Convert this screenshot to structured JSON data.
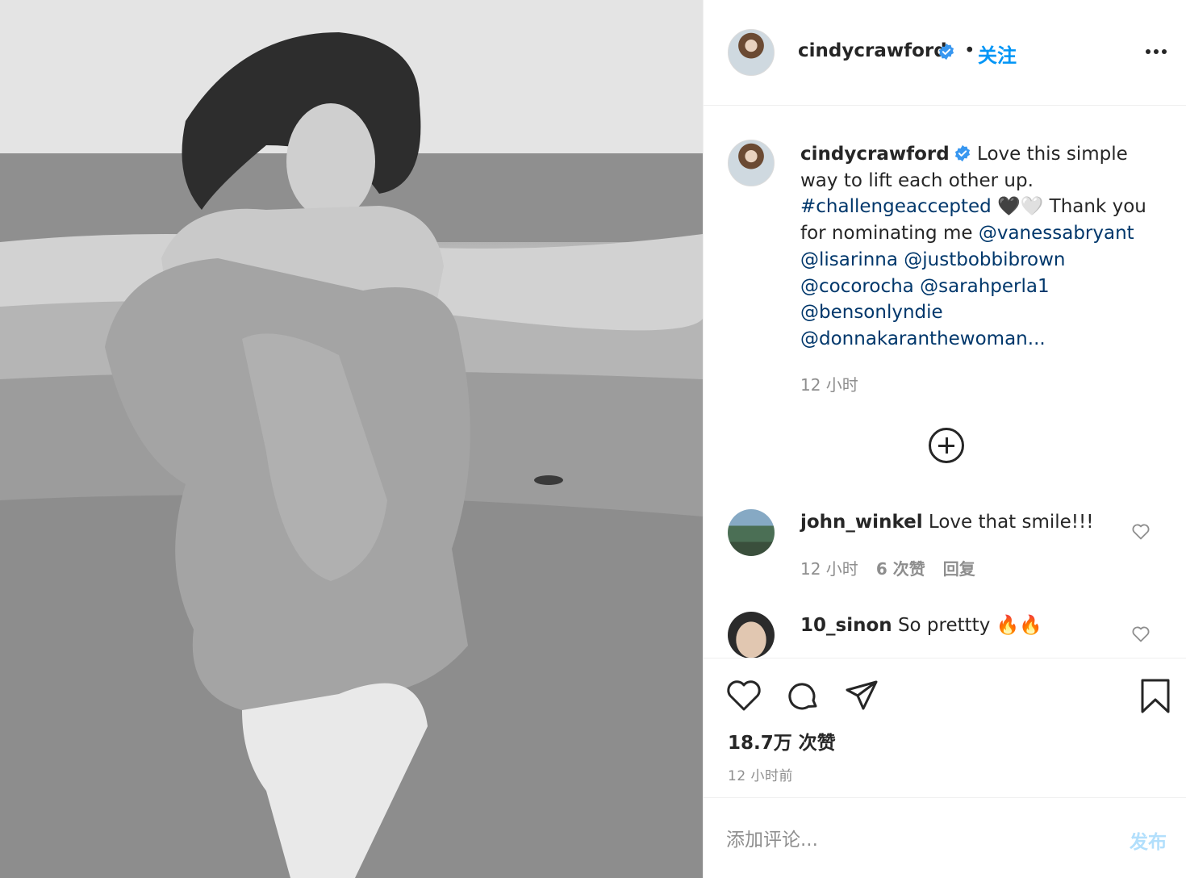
{
  "post": {
    "image": {
      "subject": "beach-portrait"
    }
  },
  "header": {
    "username": "cindycrawford",
    "separator": "•",
    "follow_label": "关注",
    "verified_icon": "verified-badge-icon",
    "more_icon": "more-options-icon"
  },
  "caption": {
    "username": "cindycrawford",
    "text_1": " Love this simple way to lift each other up. ",
    "hashtag": "#challengeaccepted",
    "emoji": " 🖤🤍 ",
    "text_2": "Thank you for nominating me ",
    "mentions": [
      "@vanessabryant",
      "@lisarinna",
      "@justbobbibrown",
      "@cocorocha",
      "@sarahperla1",
      "@bensonlyndie",
      "@donnakaranthewoman..."
    ],
    "time": "12 小时"
  },
  "load_more_icon": "plus-circle-icon",
  "comments": [
    {
      "username": "john_winkel",
      "text": " Love that smile!!!",
      "time": "12 小时",
      "likes": "6 次赞",
      "reply": "回复"
    },
    {
      "username": "10_sinon",
      "text": " So prettty 🔥🔥"
    }
  ],
  "actions": {
    "icons": [
      "heart-icon",
      "comment-icon",
      "share-icon",
      "bookmark-icon"
    ],
    "likes": "18.7万 次赞",
    "posted": "12 小时前"
  },
  "comment_bar": {
    "placeholder": "添加评论...",
    "post_label": "发布"
  },
  "colors": {
    "accent": "#0095f6",
    "link": "#00376b",
    "muted": "#8e8e8e",
    "post_disabled": "#b2dffc"
  }
}
